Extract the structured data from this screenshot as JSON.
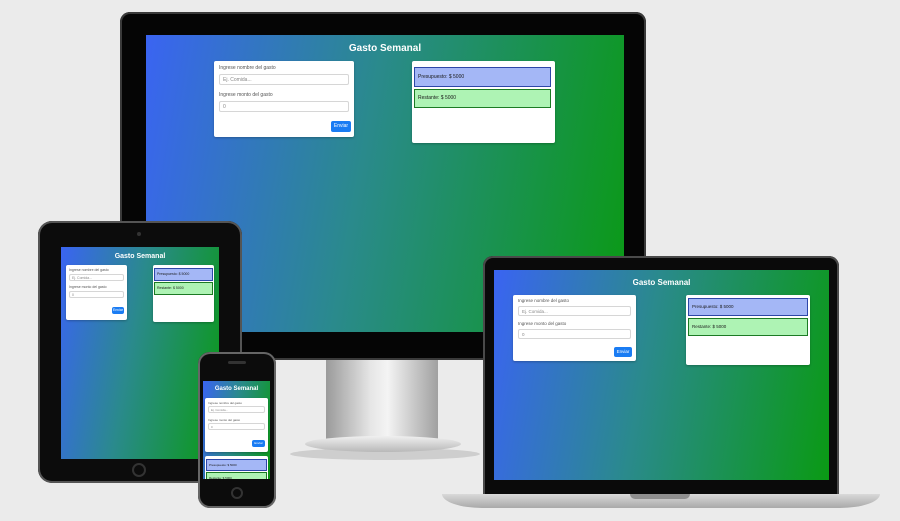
{
  "app": {
    "title": "Gasto Semanal",
    "label_name": "Ingrese nombre del gasto",
    "placeholder_name": "Ej. Comida...",
    "label_amount": "Ingrese monto del gasto",
    "value_amount": "0",
    "submit": "Enviar",
    "budget": "Presupuesto: $ 5000",
    "remaining": "Restante: $ 5000"
  },
  "colors": {
    "gradient_start": "#3a64f2",
    "gradient_end": "#0a9a14",
    "button": "#1a7cf3",
    "budget_bg": "#a4b7f6",
    "remaining_bg": "#aef3b4"
  }
}
